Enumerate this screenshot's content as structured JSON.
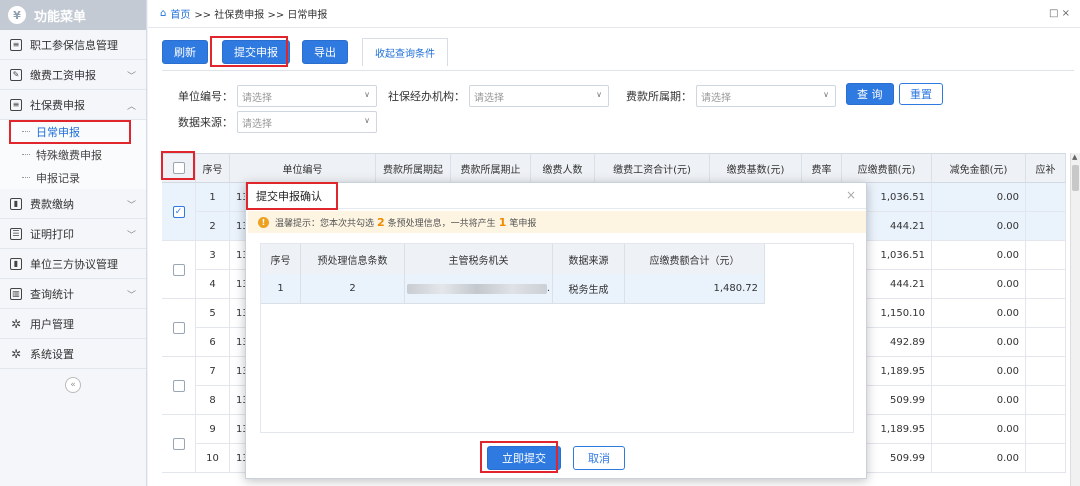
{
  "sidebar": {
    "title": "功能菜单",
    "logo": "¥",
    "items": [
      {
        "label": "职工参保信息管理",
        "icon": "id-card-icon"
      },
      {
        "label": "缴费工资申报",
        "icon": "edit-icon",
        "expandable": true
      },
      {
        "label": "社保费申报",
        "icon": "document-icon",
        "expanded": true
      },
      {
        "label": "费款缴纳",
        "icon": "book-icon",
        "expandable": true
      },
      {
        "label": "证明打印",
        "icon": "list-icon",
        "expandable": true
      },
      {
        "label": "单位三方协议管理",
        "icon": "book-icon"
      },
      {
        "label": "查询统计",
        "icon": "chart-icon",
        "expandable": true
      },
      {
        "label": "用户管理",
        "icon": "gear-icon"
      },
      {
        "label": "系统设置",
        "icon": "gear-icon"
      }
    ],
    "subitems": [
      "日常申报",
      "特殊缴费申报",
      "申报记录"
    ],
    "collapse": "«"
  },
  "breadcrumb": {
    "home": "首页",
    "rest": ">> 社保费申报 >> 日常申报",
    "max": "□ ×"
  },
  "toolbar": {
    "refresh": "刷新",
    "submit": "提交申报",
    "export": "导出",
    "tab": "收起查询条件"
  },
  "filters": {
    "unit_code_label": "单位编号：",
    "agency_label": "社保经办机构：",
    "period_label": "费款所属期：",
    "source_label": "数据来源：",
    "placeholder": "请选择",
    "query": "查 询",
    "reset": "重置"
  },
  "table": {
    "headers": [
      "序号",
      "单位编号",
      "费款所属期起",
      "费款所属期止",
      "缴费人数",
      "缴费工资合计(元)",
      "缴费基数(元)",
      "费率",
      "应缴费额(元)",
      "减免金额(元)",
      "应补"
    ],
    "code_prefix": "13",
    "rows": [
      {
        "no": "1",
        "due": "1,036.51",
        "reduce": "0.00"
      },
      {
        "no": "2",
        "due": "444.21",
        "reduce": "0.00"
      },
      {
        "no": "3",
        "due": "1,036.51",
        "reduce": "0.00"
      },
      {
        "no": "4",
        "due": "444.21",
        "reduce": "0.00"
      },
      {
        "no": "5",
        "due": "1,150.10",
        "reduce": "0.00"
      },
      {
        "no": "6",
        "due": "492.89",
        "reduce": "0.00"
      },
      {
        "no": "7",
        "due": "1,189.95",
        "reduce": "0.00"
      },
      {
        "no": "8",
        "due": "509.99",
        "reduce": "0.00"
      },
      {
        "no": "9",
        "due": "1,189.95",
        "reduce": "0.00"
      },
      {
        "no": "10",
        "due": "509.99",
        "reduce": "0.00"
      }
    ]
  },
  "modal": {
    "title": "提交申报确认",
    "close": "×",
    "tip_prefix": "温馨提示：您本次共勾选",
    "tip_count": "2",
    "tip_middle": "条预处理信息，一共将产生",
    "tip_result": "1",
    "tip_suffix": "笔申报",
    "headers": [
      "序号",
      "预处理信息条数",
      "主管税务机关",
      "数据来源",
      "应缴费额合计（元）"
    ],
    "row": {
      "no": "1",
      "count": "2",
      "tax_office_suffix": ".",
      "source": "税务生成",
      "total": "1,480.72"
    },
    "submit": "立即提交",
    "cancel": "取消"
  },
  "colors": {
    "accent": "#2e7ae0",
    "highlight_box": "#e0262c",
    "tip_bg": "#fdf5e2",
    "tip_number": "#f08a00"
  }
}
